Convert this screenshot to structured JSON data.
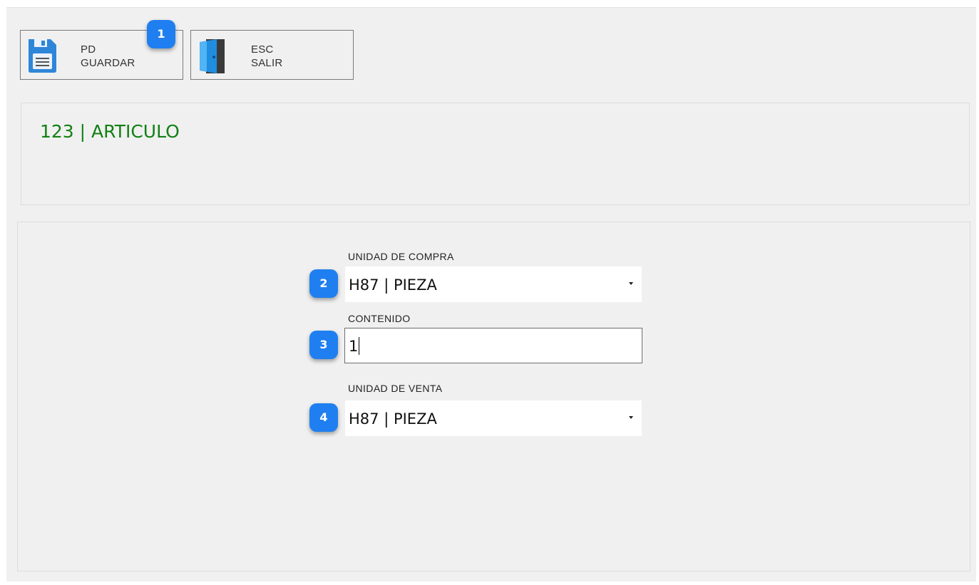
{
  "toolbar": {
    "save": {
      "key": "PD",
      "label": "GUARDAR",
      "icon": "floppy-disk-icon"
    },
    "exit": {
      "key": "ESC",
      "label": "SALIR",
      "icon": "door-exit-icon"
    }
  },
  "header": {
    "title": "123 | ARTICULO",
    "title_color": "#128013"
  },
  "form": {
    "unidad_compra": {
      "label": "UNIDAD DE COMPRA",
      "value": "H87 | PIEZA"
    },
    "contenido": {
      "label": "CONTENIDO",
      "value": "1"
    },
    "unidad_venta": {
      "label": "UNIDAD DE VENTA",
      "value": "H87 | PIEZA"
    }
  },
  "annotations": {
    "badge_color": "#1f7ff0",
    "items": [
      "1",
      "2",
      "3",
      "4"
    ]
  }
}
